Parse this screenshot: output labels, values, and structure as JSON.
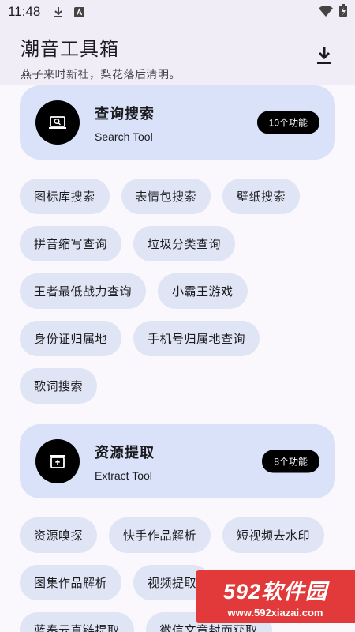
{
  "status_bar": {
    "time": "11:48"
  },
  "app_bar": {
    "title": "潮音工具箱",
    "subtitle": "燕子来时新社，梨花落后清明。",
    "download_icon": "download-icon"
  },
  "categories": [
    {
      "title": "查询搜索",
      "subtitle": "Search Tool",
      "badge": "10个功能",
      "icon": "search-screen-icon",
      "items": [
        "图标库搜索",
        "表情包搜索",
        "壁纸搜索",
        "拼音缩写查询",
        "垃圾分类查询",
        "王者最低战力查询",
        "小霸王游戏",
        "身份证归属地",
        "手机号归属地查询",
        "歌词搜索"
      ]
    },
    {
      "title": "资源提取",
      "subtitle": "Extract Tool",
      "badge": "8个功能",
      "icon": "extract-box-icon",
      "items": [
        "资源嗅探",
        "快手作品解析",
        "短视频去水印",
        "图集作品解析",
        "视频提取",
        "蓝奏云直链提取",
        "微信文章封面获取"
      ]
    }
  ],
  "watermark": {
    "main": "592软件园",
    "url": "www.592xiazai.com"
  },
  "colors": {
    "card_bg": "#d9e2f8",
    "chip_bg": "#dfe5f5",
    "app_bar_bg": "#f1edf6",
    "watermark_bg": "#e23a3a"
  }
}
